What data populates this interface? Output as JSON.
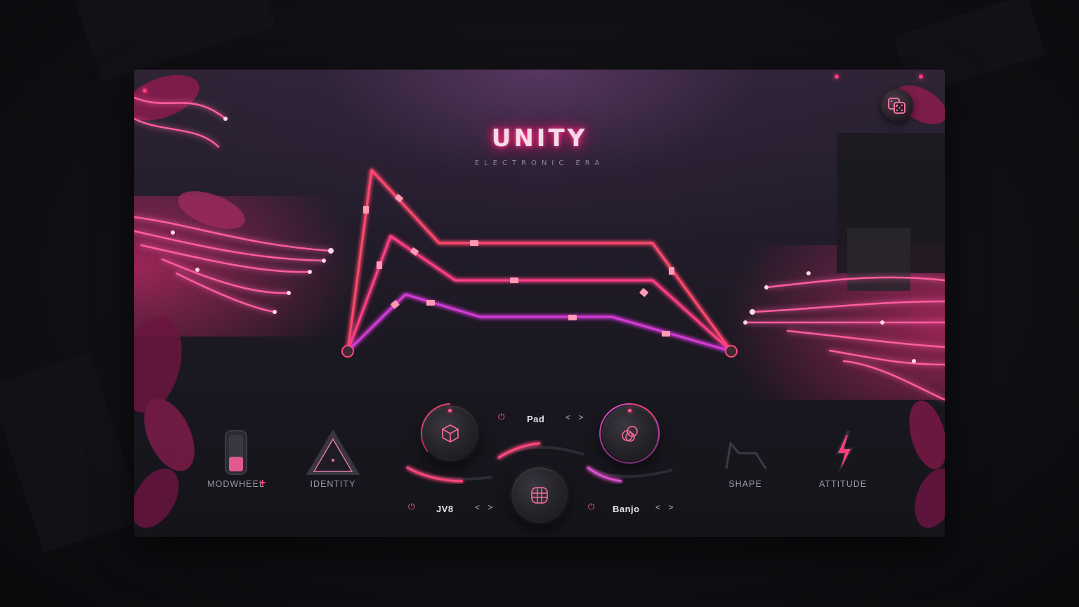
{
  "background": {
    "color": "#111014"
  },
  "plugin": {
    "logo": {
      "title": "UNITY",
      "subtitle": "ELECTRONIC ERA"
    },
    "accent_colors": {
      "pink": "#ff3b7a",
      "magenta": "#d53bd6",
      "red": "#ff2d55"
    },
    "dice_button": {
      "icon": "dice-icon"
    },
    "left_controls": [
      {
        "label": "MODWHEEL",
        "icon": "modwheel-icon",
        "level": 0.4,
        "badge": "+"
      },
      {
        "label": "IDENTITY",
        "icon": "triangle-icon"
      }
    ],
    "right_controls": [
      {
        "label": "SHAPE",
        "icon": "shape-envelope-icon"
      },
      {
        "label": "ATTITUDE",
        "icon": "lightning-icon"
      }
    ],
    "slots": [
      {
        "name": "Pad",
        "icon": "cube-icon",
        "power": "on"
      },
      {
        "name": "JV8",
        "icon": "grid-sphere-icon",
        "power": "on"
      },
      {
        "name": "Banjo",
        "icon": "circles-icon",
        "power": "on"
      }
    ],
    "slot_nav": {
      "arrows": "< >"
    }
  }
}
